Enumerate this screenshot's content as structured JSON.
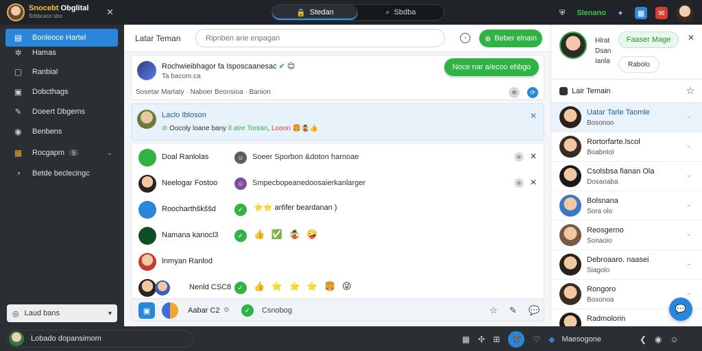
{
  "brand": {
    "name_a": "Snocebt",
    "name_b": "Obglital",
    "sub": "Srbbcaso sbo"
  },
  "top": {
    "seg_active": "Stedan",
    "seg_other": "Sbdba",
    "status": "Slenano"
  },
  "sidebar": {
    "items": [
      {
        "label": "Bonleoce Hartel",
        "icon": "▤"
      },
      {
        "label": "Hamas",
        "icon": "✲"
      },
      {
        "label": "Ranbial",
        "icon": "▢"
      },
      {
        "label": "Dobcthags",
        "icon": "▣"
      },
      {
        "label": "Doeert Dbgems",
        "icon": "✎"
      },
      {
        "label": "Benbens",
        "icon": "◉"
      },
      {
        "label": "Rocgapm",
        "icon": "▦",
        "badge": "5"
      },
      {
        "label": "Betde beclecingc",
        "icon": "◔"
      }
    ],
    "select_label": "Laud bans"
  },
  "main": {
    "title": "Latar Teman",
    "search_placeholder": "Ripnben arie enpagan",
    "btn_primary": "Beber elnain",
    "post": {
      "title": "Rochwieibhagor fa",
      "title_extra": "Isposcaanesac",
      "sub": "Ta bacom.ca",
      "meta": "Sosetar Martaty · Naboer Beonsioa · Banion",
      "bubble": "Noce nar a/ecoo ehbgo"
    },
    "highlight": {
      "name": "Laclo Ibloson",
      "sub_a": "Oocoly loane bany",
      "sub_b": "Il atre Tontan",
      "sub_c": "Looon"
    },
    "rows": [
      {
        "name": "Doal Ranlolas",
        "text": "Soeer Sporbon &doton harnoae"
      },
      {
        "name": "Neelogar Fostoo",
        "text": "Smpecbopeanedoosaierkanlarger"
      },
      {
        "name": "Roocharthškššd",
        "emoji": "⭐⭐ ar6fer beardanan )"
      },
      {
        "name": "Namana kanocl3",
        "emoji": "👍 ✅ 🤹 🤪"
      },
      {
        "name": "Inmyan Ranlod"
      },
      {
        "name": "Nenld CSC8",
        "emoji": "👍 ⭐ ⭐ ⭐ 🍔 😜"
      }
    ],
    "composer": {
      "name": "Aabar C2",
      "text": "Csnobog"
    }
  },
  "rpanel": {
    "profile": {
      "l1": "Hlrat",
      "l2": "Dsan",
      "l3": "Ianla",
      "btn1": "Faaser Mage",
      "btn2": "Rabolo"
    },
    "list_title": "Lair Temain",
    "contacts": [
      {
        "name": "Uatar Tarle Taomle",
        "status": "Bosonoo"
      },
      {
        "name": "Rortorfarte.lscol",
        "status": "Boabntol"
      },
      {
        "name": "Csolsbsa fianan Ola",
        "status": "Dosaoaba"
      },
      {
        "name": "Bolsnana",
        "status": "Sora olo"
      },
      {
        "name": "Reosgerno",
        "status": "Sonaoio"
      },
      {
        "name": "Debroaaro. naasei",
        "status": "Siagolo"
      },
      {
        "name": "Rongoro",
        "status": "Bosonoa"
      },
      {
        "name": "Radmolorin"
      }
    ]
  },
  "bottom": {
    "user": "Lobado dopansimom",
    "label": "Maesogone"
  },
  "colors": {
    "accent_blue": "#2a86d8",
    "accent_green": "#2fb344",
    "dark": "#2b2e33"
  }
}
